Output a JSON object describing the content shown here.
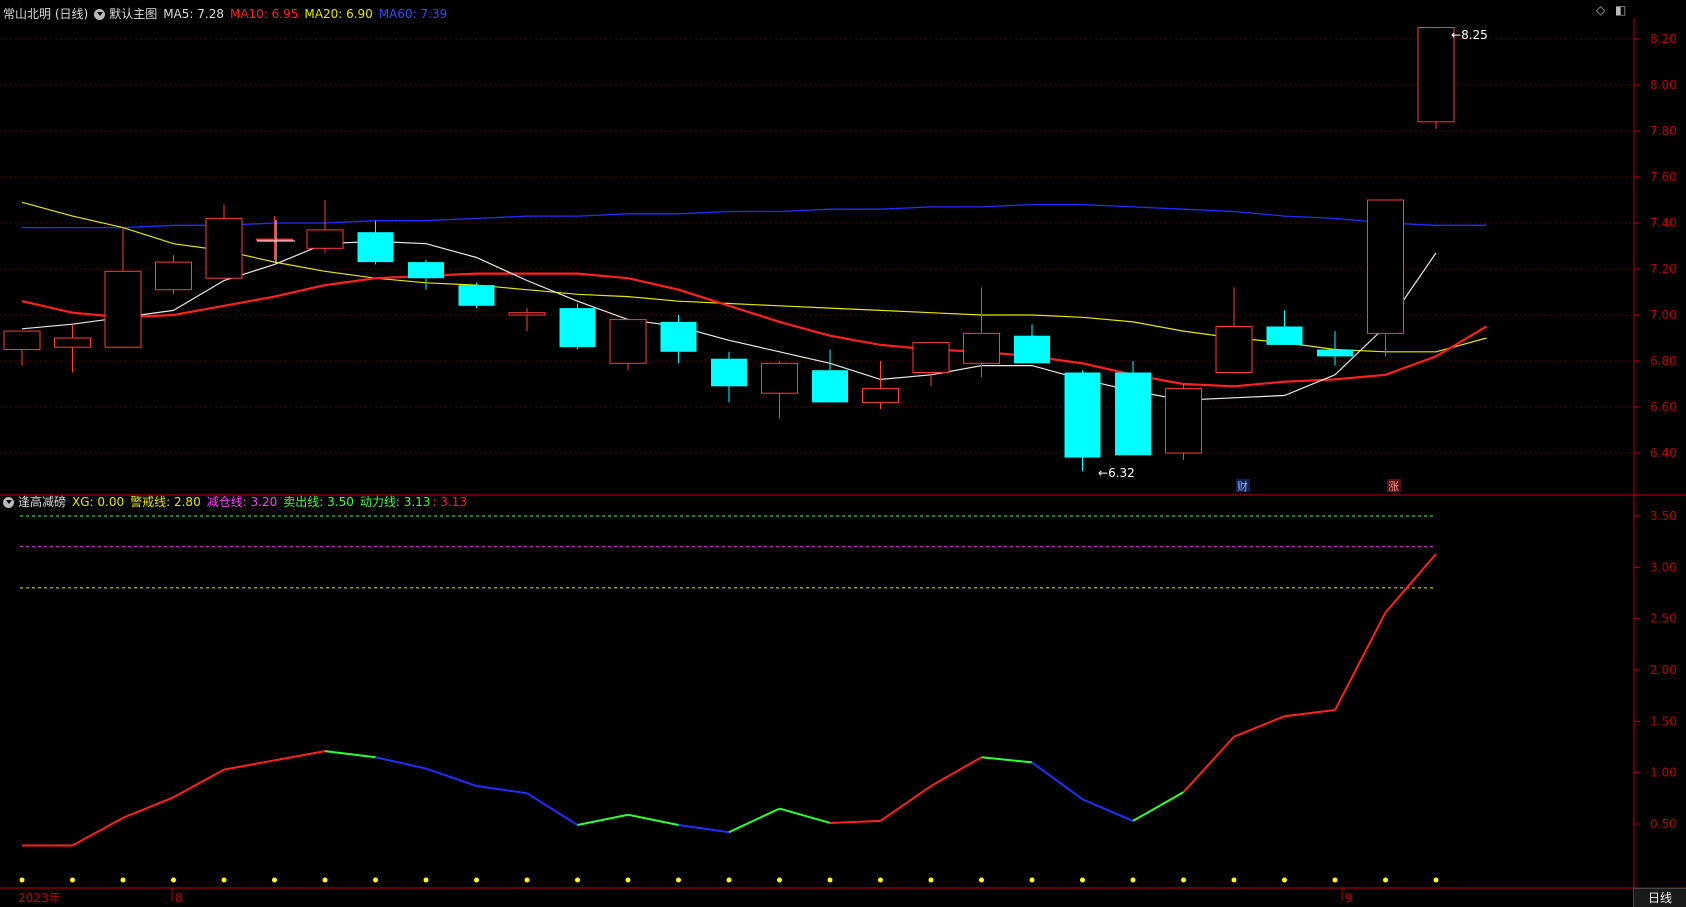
{
  "main_header": {
    "stock": "常山北明 (日线)",
    "template": "默认主图",
    "ma5_label": "MA5: 7.28",
    "ma10_label": "MA10: 6.95",
    "ma20_label": "MA20: 6.90",
    "ma60_label": "MA60: 7.39"
  },
  "sub_header": {
    "indicator": "逢高减磅",
    "xg_label": "XG: 0.00",
    "warn_label": "警戒线: 2.80",
    "reduce_label": "减仓线: 3.20",
    "sell_label": "卖出线: 3.50",
    "power_label": "动力线: 3.13",
    "power_value": "3.13"
  },
  "colors": {
    "up": "#ff3b3b",
    "down": "#00ffff",
    "ma5": "#e8e8e8",
    "ma10": "#ff2020",
    "ma20": "#e6e600",
    "ma60": "#2030ff",
    "grid": "#5a0000",
    "axis": "#c00000",
    "warn": "#e6e600",
    "reduce": "#ff40ff",
    "sell": "#40ff40"
  },
  "annotations": {
    "high": "8.25",
    "low": "6.32",
    "tag_cai": "财",
    "tag_zhang": "涨"
  },
  "dates": {
    "year": "2023年",
    "aug": "8",
    "sep": "9"
  },
  "timeframe_tab": "日线",
  "chart_data": [
    {
      "type": "candlestick",
      "title": "常山北明 (日线)",
      "y_ticks": [
        "8.20",
        "8.00",
        "7.80",
        "7.60",
        "7.40",
        "7.20",
        "7.00",
        "6.80",
        "6.60",
        "6.40"
      ],
      "ylim": [
        6.3,
        8.28
      ],
      "candles": [
        {
          "o": 6.85,
          "c": 6.93,
          "h": 6.93,
          "l": 6.78
        },
        {
          "o": 6.86,
          "c": 6.9,
          "h": 6.96,
          "l": 6.75
        },
        {
          "o": 6.86,
          "c": 7.19,
          "h": 7.38,
          "l": 6.86
        },
        {
          "o": 7.11,
          "c": 7.23,
          "h": 7.26,
          "l": 7.09
        },
        {
          "o": 7.16,
          "c": 7.42,
          "h": 7.48,
          "l": 7.16
        },
        {
          "o": 7.33,
          "c": 7.33,
          "h": 7.43,
          "l": 7.24
        },
        {
          "o": 7.29,
          "c": 7.37,
          "h": 7.5,
          "l": 7.27
        },
        {
          "o": 7.36,
          "c": 7.23,
          "h": 7.41,
          "l": 7.22
        },
        {
          "o": 7.23,
          "c": 7.16,
          "h": 7.24,
          "l": 7.11
        },
        {
          "o": 7.13,
          "c": 7.04,
          "h": 7.14,
          "l": 7.03
        },
        {
          "o": 7.0,
          "c": 7.01,
          "h": 7.03,
          "l": 6.93
        },
        {
          "o": 7.03,
          "c": 6.86,
          "h": 7.05,
          "l": 6.85
        },
        {
          "o": 6.79,
          "c": 6.98,
          "h": 6.98,
          "l": 6.76
        },
        {
          "o": 6.97,
          "c": 6.84,
          "h": 7.0,
          "l": 6.79
        },
        {
          "o": 6.81,
          "c": 6.69,
          "h": 6.84,
          "l": 6.62
        },
        {
          "o": 6.66,
          "c": 6.79,
          "h": 6.8,
          "l": 6.55
        },
        {
          "o": 6.76,
          "c": 6.62,
          "h": 6.85,
          "l": 6.62
        },
        {
          "o": 6.62,
          "c": 6.68,
          "h": 6.8,
          "l": 6.59
        },
        {
          "o": 6.75,
          "c": 6.88,
          "h": 6.88,
          "l": 6.69
        },
        {
          "o": 6.79,
          "c": 6.92,
          "h": 7.12,
          "l": 6.73
        },
        {
          "o": 6.91,
          "c": 6.79,
          "h": 6.96,
          "l": 6.79
        },
        {
          "o": 6.75,
          "c": 6.38,
          "h": 6.76,
          "l": 6.32
        },
        {
          "o": 6.75,
          "c": 6.39,
          "h": 6.8,
          "l": 6.39
        },
        {
          "o": 6.4,
          "c": 6.68,
          "h": 6.7,
          "l": 6.37
        },
        {
          "o": 6.75,
          "c": 6.95,
          "h": 7.12,
          "l": 6.75
        },
        {
          "o": 6.95,
          "c": 6.87,
          "h": 7.02,
          "l": 6.87
        },
        {
          "o": 6.85,
          "c": 6.82,
          "h": 6.93,
          "l": 6.78
        },
        {
          "o": 6.92,
          "c": 7.5,
          "h": 7.5,
          "l": 6.82
        },
        {
          "o": 7.84,
          "c": 8.25,
          "h": 8.25,
          "l": 7.81
        }
      ],
      "ma5": [
        6.94,
        6.96,
        6.99,
        7.02,
        7.15,
        7.22,
        7.31,
        7.32,
        7.31,
        7.25,
        7.15,
        7.06,
        6.98,
        6.95,
        6.89,
        6.84,
        6.79,
        6.72,
        6.74,
        6.78,
        6.78,
        6.72,
        6.67,
        6.63,
        6.64,
        6.65,
        6.74,
        6.95,
        7.27
      ],
      "ma10": [
        7.06,
        7.01,
        6.99,
        7.0,
        7.04,
        7.08,
        7.13,
        7.16,
        7.17,
        7.18,
        7.18,
        7.18,
        7.16,
        7.11,
        7.04,
        6.97,
        6.91,
        6.87,
        6.85,
        6.84,
        6.82,
        6.79,
        6.74,
        6.7,
        6.69,
        6.71,
        6.72,
        6.74,
        6.82,
        6.95
      ],
      "ma20": [
        7.49,
        7.43,
        7.38,
        7.31,
        7.28,
        7.23,
        7.19,
        7.16,
        7.14,
        7.13,
        7.11,
        7.09,
        7.08,
        7.06,
        7.05,
        7.04,
        7.03,
        7.02,
        7.01,
        7.0,
        7.0,
        6.99,
        6.97,
        6.93,
        6.9,
        6.88,
        6.85,
        6.84,
        6.84,
        6.9
      ],
      "ma60": [
        7.38,
        7.38,
        7.38,
        7.39,
        7.39,
        7.4,
        7.4,
        7.41,
        7.41,
        7.42,
        7.43,
        7.43,
        7.44,
        7.44,
        7.45,
        7.45,
        7.46,
        7.46,
        7.47,
        7.47,
        7.48,
        7.48,
        7.47,
        7.46,
        7.45,
        7.43,
        7.42,
        7.4,
        7.39,
        7.39
      ]
    },
    {
      "type": "line",
      "title": "逢高减磅",
      "y_ticks": [
        "3.50",
        "3.00",
        "2.50",
        "2.00",
        "1.50",
        "1.00",
        "0.50"
      ],
      "ylim": [
        0.0,
        3.68
      ],
      "power_line": [
        0.29,
        0.29,
        0.56,
        0.76,
        1.03,
        1.12,
        1.21,
        1.15,
        1.04,
        0.87,
        0.8,
        0.49,
        0.59,
        0.49,
        0.42,
        0.65,
        0.51,
        0.53,
        0.87,
        1.15,
        1.1,
        0.74,
        0.53,
        0.81,
        1.35,
        1.55,
        1.61,
        2.56,
        3.13
      ],
      "segment_colors": [
        "red",
        "red",
        "red",
        "red",
        "red",
        "red",
        "green",
        "blue",
        "blue",
        "blue",
        "blue",
        "green",
        "green",
        "blue",
        "green",
        "green",
        "red",
        "red",
        "red",
        "green",
        "blue",
        "blue",
        "green",
        "red",
        "red",
        "red",
        "red",
        "red"
      ],
      "warn_line": 2.8,
      "reduce_line": 3.2,
      "sell_line": 3.5
    }
  ]
}
